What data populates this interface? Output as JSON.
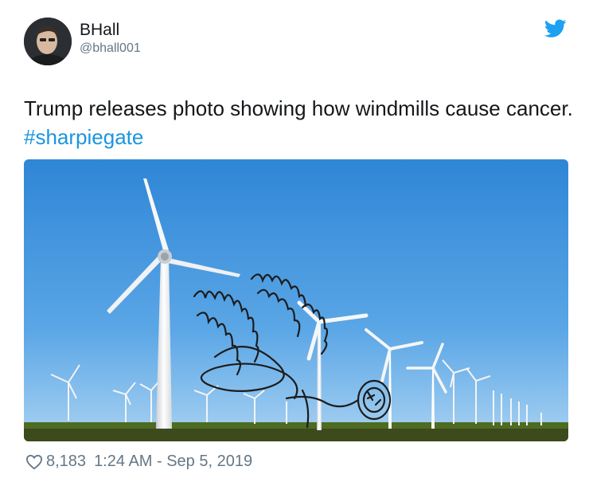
{
  "user": {
    "display_name": "BHall",
    "handle": "@bhall001"
  },
  "tweet": {
    "text": "Trump releases photo showing how windmills cause cancer.",
    "hashtag": "#sharpiegate"
  },
  "footer": {
    "likes": "8,183",
    "timestamp": "1:24 AM - Sep 5, 2019"
  },
  "icons": {
    "brand": "twitter-bird-icon",
    "like": "heart-icon"
  },
  "colors": {
    "brand_blue": "#1da1f2",
    "hashtag": "#1b95e0",
    "muted": "#657786",
    "text": "#14171a"
  }
}
